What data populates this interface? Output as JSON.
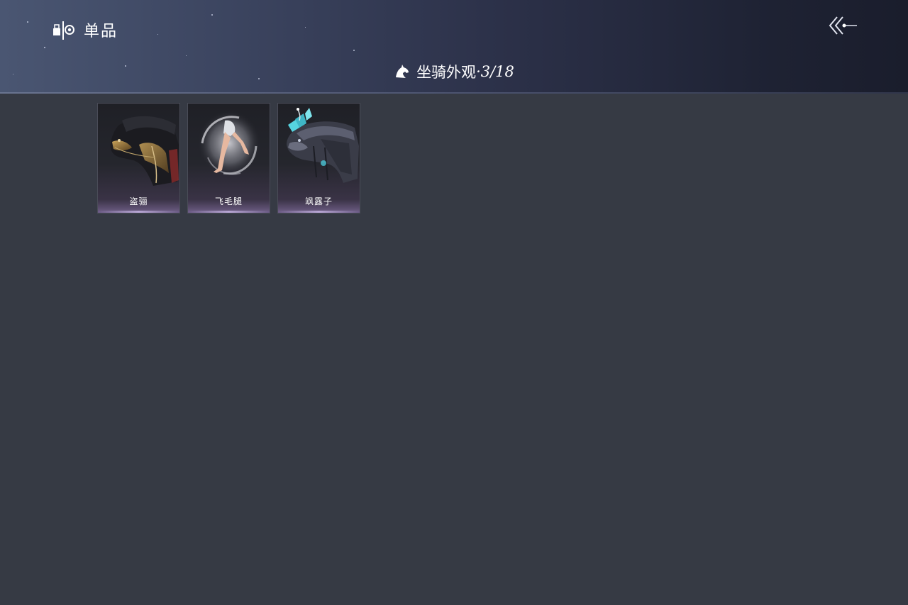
{
  "header": {
    "section_title": "单品",
    "section_icon": "shop-item-icon",
    "back_icon": "back-arrow-icon"
  },
  "category": {
    "icon": "horse-head-icon",
    "label": "坐骑外观",
    "separator": "·",
    "count": "3/18"
  },
  "items": [
    {
      "name": "盗骊",
      "art_icon": "dark-armored-horse-icon"
    },
    {
      "name": "飞毛腿",
      "art_icon": "swirling-legs-icon"
    },
    {
      "name": "飒露子",
      "art_icon": "blue-flower-horse-icon"
    }
  ],
  "colors": {
    "background": "#363a44",
    "card_accent": "#b8a6d4",
    "text": "#ffffff"
  }
}
